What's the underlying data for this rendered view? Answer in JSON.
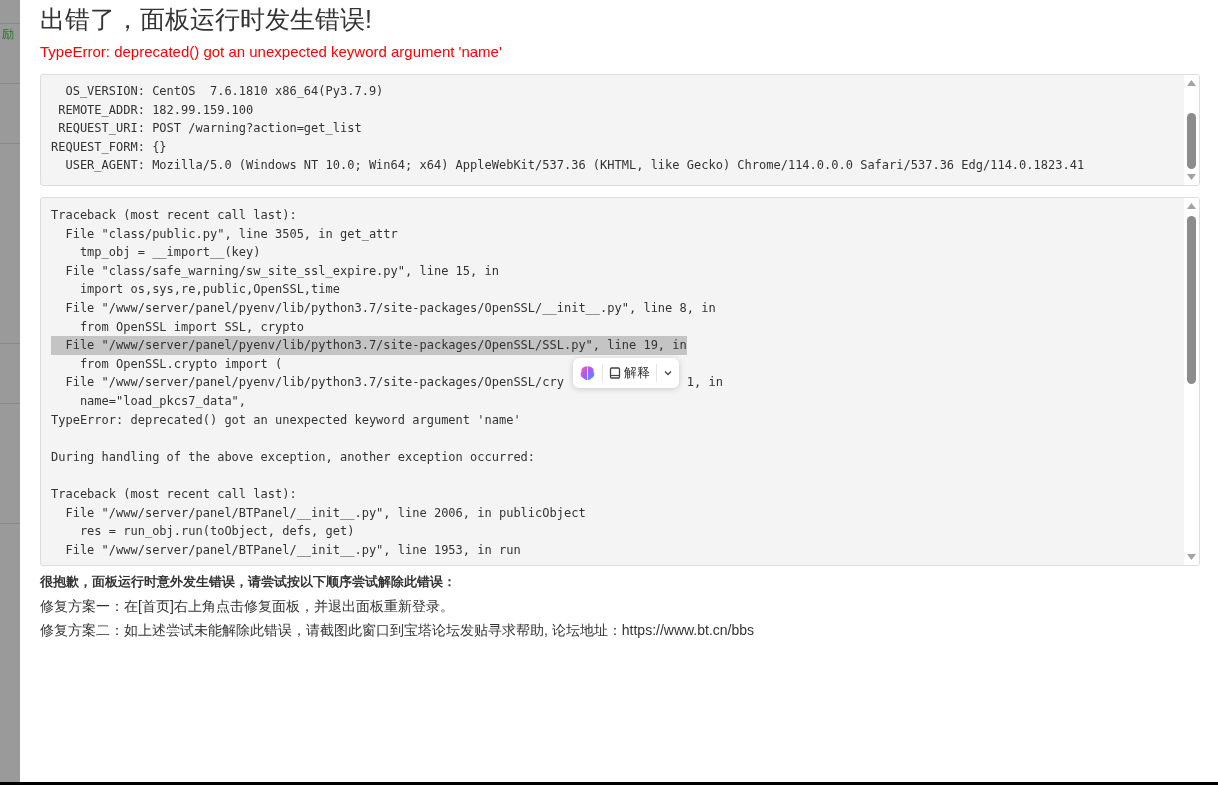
{
  "sidebar": {
    "label": "励"
  },
  "title": "出错了，面板运行时发生错误!",
  "error_message": "TypeError: deprecated() got an unexpected keyword argument 'name'",
  "env_box": {
    "lines": [
      "  OS_VERSION: CentOS  7.6.1810 x86_64(Py3.7.9)",
      " REMOTE_ADDR: 182.99.159.100",
      " REQUEST_URI: POST /warning?action=get_list",
      "REQUEST_FORM: {}",
      "  USER_AGENT: Mozilla/5.0 (Windows NT 10.0; Win64; x64) AppleWebKit/537.36 (KHTML, like Gecko) Chrome/114.0.0.0 Safari/537.36 Edg/114.0.1823.41"
    ]
  },
  "traceback_box": {
    "lines": [
      {
        "kind": "text",
        "text": "Traceback (most recent call last):",
        "highlighted": false
      },
      {
        "kind": "text",
        "text": "  File \"class/public.py\", line 3505, in get_attr",
        "highlighted": false
      },
      {
        "kind": "text",
        "text": "    tmp_obj = __import__(key)",
        "highlighted": false
      },
      {
        "kind": "text",
        "text": "  File \"class/safe_warning/sw_site_ssl_expire.py\", line 15, in",
        "highlighted": false
      },
      {
        "kind": "text",
        "text": "    import os,sys,re,public,OpenSSL,time",
        "highlighted": false
      },
      {
        "kind": "text",
        "text": "  File \"/www/server/panel/pyenv/lib/python3.7/site-packages/OpenSSL/__init__.py\", line 8, in",
        "highlighted": false
      },
      {
        "kind": "text",
        "text": "    from OpenSSL import SSL, crypto",
        "highlighted": false
      },
      {
        "kind": "text",
        "text": "  File \"/www/server/panel/pyenv/lib/python3.7/site-packages/OpenSSL/SSL.py\", line 19, in",
        "highlighted": true
      },
      {
        "kind": "text",
        "text": "    from OpenSSL.crypto import (",
        "highlighted": false
      },
      {
        "kind": "split",
        "parts": [
          "  File \"/www/server/panel/pyenv/lib/python3.7/site-packages/OpenSSL/cry",
          "1, in"
        ],
        "highlighted": false
      },
      {
        "kind": "text",
        "text": "    name=\"load_pkcs7_data\",",
        "highlighted": false
      },
      {
        "kind": "text",
        "text": "TypeError: deprecated() got an unexpected keyword argument 'name'",
        "highlighted": false
      },
      {
        "kind": "blank",
        "highlighted": false
      },
      {
        "kind": "text",
        "text": "During handling of the above exception, another exception occurred:",
        "highlighted": false
      },
      {
        "kind": "blank",
        "highlighted": false
      },
      {
        "kind": "text",
        "text": "Traceback (most recent call last):",
        "highlighted": false
      },
      {
        "kind": "text",
        "text": "  File \"/www/server/panel/BTPanel/__init__.py\", line 2006, in publicObject",
        "highlighted": false
      },
      {
        "kind": "text",
        "text": "    res = run_obj.run(toObject, defs, get)",
        "highlighted": false
      },
      {
        "kind": "text",
        "text": "  File \"/www/server/panel/BTPanel/__init__.py\", line 1953, in run",
        "highlighted": false
      }
    ]
  },
  "popup": {
    "label": "解释"
  },
  "help": {
    "heading": "很抱歉，面板运行时意外发生错误，请尝试按以下顺序尝试解除此错误：",
    "lines": [
      "修复方案一：在[首页]右上角点击修复面板，并退出面板重新登录。",
      "修复方案二：如上述尝试未能解除此错误，请截图此窗口到宝塔论坛发贴寻求帮助, 论坛地址：https://www.bt.cn/bbs"
    ]
  }
}
